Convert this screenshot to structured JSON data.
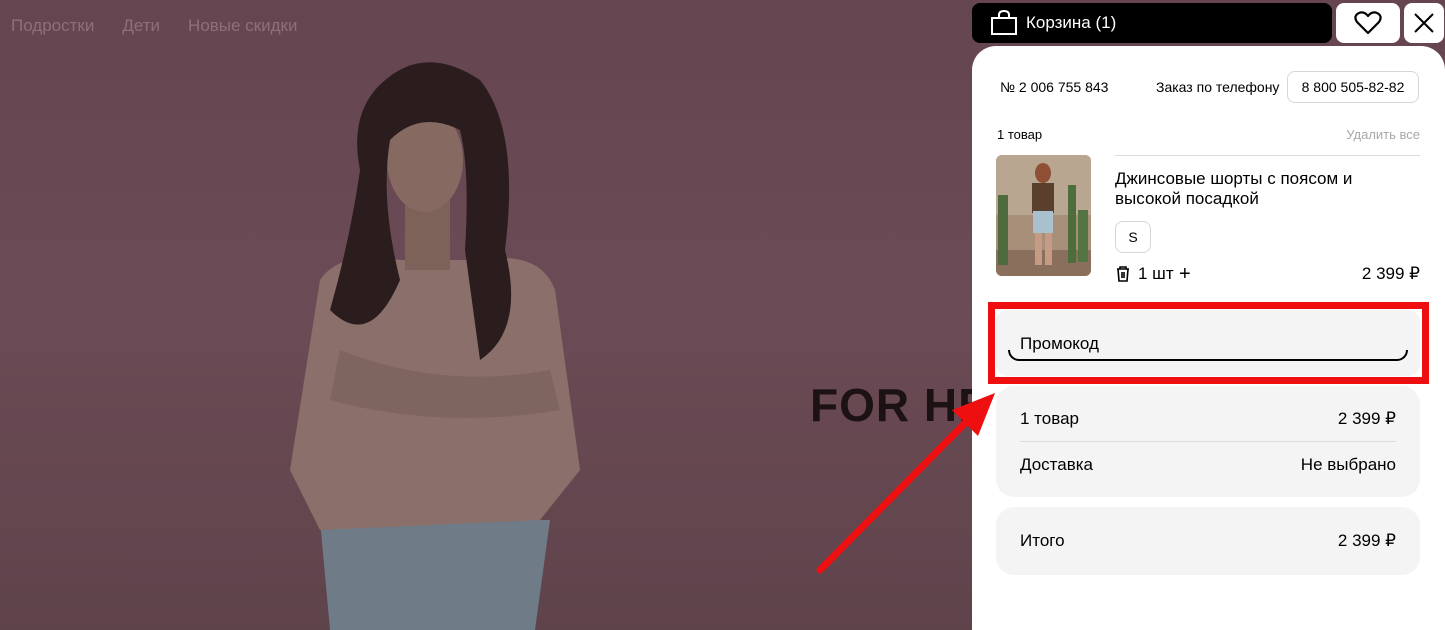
{
  "nav": [
    "Подростки",
    "Дети",
    "Новые скидки"
  ],
  "hero": {
    "text": "FOR HER"
  },
  "header": {
    "cart_label": "Корзина (1)"
  },
  "order": {
    "number": "№ 2 006 755 843",
    "phone_label": "Заказ по телефону",
    "phone": "8 800 505-82-82"
  },
  "cart": {
    "count": "1 товар",
    "delete_all": "Удалить все",
    "item": {
      "title": "Джинсовые шорты с поясом и высокой посадкой",
      "size": "S",
      "qty": "1 шт",
      "price": "2 399 ₽"
    }
  },
  "promo": {
    "label": "Промокод"
  },
  "summary": {
    "items_label": "1 товар",
    "items_value": "2 399 ₽",
    "delivery_label": "Доставка",
    "delivery_value": "Не выбрано"
  },
  "total": {
    "label": "Итого",
    "value": "2 399 ₽"
  },
  "colors": {
    "annotation": "#ee1010",
    "overlay": "#5d3f48"
  }
}
